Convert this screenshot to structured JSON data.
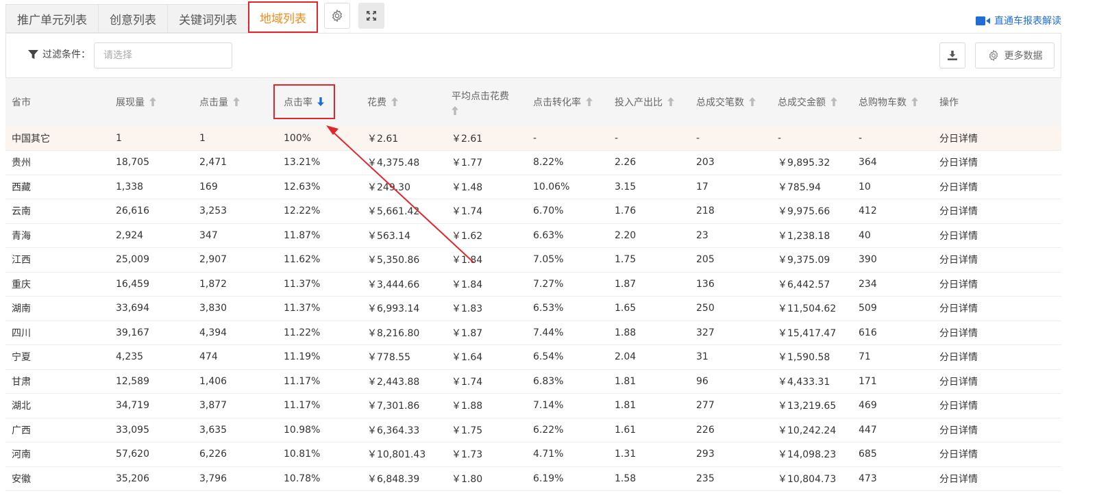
{
  "tabs": [
    {
      "label": "推广单元列表",
      "active": false
    },
    {
      "label": "创意列表",
      "active": false
    },
    {
      "label": "关键词列表",
      "active": false
    },
    {
      "label": "地域列表",
      "active": true
    }
  ],
  "help_link": "直通车报表解读",
  "filter": {
    "label": "过滤条件：",
    "placeholder": "请选择"
  },
  "more_data_label": "更多数据",
  "columns": [
    "省市",
    "展现量",
    "点击量",
    "点击率",
    "花费",
    "平均点击花费",
    "点击转化率",
    "投入产出比",
    "总成交笔数",
    "总成交金额",
    "总购物车数",
    "操作"
  ],
  "sorted_column": "点击率",
  "sort_direction": "desc",
  "rows": [
    [
      "中国其它",
      "1",
      "1",
      "100%",
      "￥2.61",
      "￥2.61",
      "-",
      "-",
      "-",
      "-",
      "-",
      "分日详情"
    ],
    [
      "贵州",
      "18,705",
      "2,471",
      "13.21%",
      "￥4,375.48",
      "￥1.77",
      "8.22%",
      "2.26",
      "203",
      "￥9,895.32",
      "364",
      "分日详情"
    ],
    [
      "西藏",
      "1,338",
      "169",
      "12.63%",
      "￥249.30",
      "￥1.48",
      "10.06%",
      "3.15",
      "17",
      "￥785.94",
      "10",
      "分日详情"
    ],
    [
      "云南",
      "26,616",
      "3,253",
      "12.22%",
      "￥5,661.42",
      "￥1.74",
      "6.70%",
      "1.76",
      "218",
      "￥9,975.66",
      "412",
      "分日详情"
    ],
    [
      "青海",
      "2,924",
      "347",
      "11.87%",
      "￥563.14",
      "￥1.62",
      "6.63%",
      "2.20",
      "23",
      "￥1,238.18",
      "40",
      "分日详情"
    ],
    [
      "江西",
      "25,009",
      "2,907",
      "11.62%",
      "￥5,350.86",
      "￥1.84",
      "7.05%",
      "1.75",
      "205",
      "￥9,375.09",
      "390",
      "分日详情"
    ],
    [
      "重庆",
      "16,459",
      "1,872",
      "11.37%",
      "￥3,444.66",
      "￥1.84",
      "7.27%",
      "1.87",
      "136",
      "￥6,442.57",
      "234",
      "分日详情"
    ],
    [
      "湖南",
      "33,694",
      "3,830",
      "11.37%",
      "￥6,993.14",
      "￥1.83",
      "6.53%",
      "1.65",
      "250",
      "￥11,504.62",
      "509",
      "分日详情"
    ],
    [
      "四川",
      "39,167",
      "4,394",
      "11.22%",
      "￥8,216.80",
      "￥1.87",
      "7.44%",
      "1.88",
      "327",
      "￥15,417.47",
      "616",
      "分日详情"
    ],
    [
      "宁夏",
      "4,235",
      "474",
      "11.19%",
      "￥778.55",
      "￥1.64",
      "6.54%",
      "2.04",
      "31",
      "￥1,590.58",
      "71",
      "分日详情"
    ],
    [
      "甘肃",
      "12,589",
      "1,406",
      "11.17%",
      "￥2,443.88",
      "￥1.74",
      "6.83%",
      "1.81",
      "96",
      "￥4,433.31",
      "171",
      "分日详情"
    ],
    [
      "湖北",
      "34,719",
      "3,877",
      "11.17%",
      "￥7,301.86",
      "￥1.88",
      "7.14%",
      "1.81",
      "277",
      "￥13,219.65",
      "469",
      "分日详情"
    ],
    [
      "广西",
      "33,095",
      "3,635",
      "10.98%",
      "￥6,364.33",
      "￥1.75",
      "6.22%",
      "1.61",
      "226",
      "￥10,242.24",
      "447",
      "分日详情"
    ],
    [
      "河南",
      "57,620",
      "6,226",
      "10.81%",
      "￥10,801.43",
      "￥1.73",
      "4.71%",
      "1.31",
      "293",
      "￥14,098.23",
      "685",
      "分日详情"
    ],
    [
      "安徽",
      "35,206",
      "3,796",
      "10.78%",
      "￥6,848.39",
      "￥1.80",
      "6.19%",
      "1.58",
      "235",
      "￥10,804.73",
      "473",
      "分日详情"
    ]
  ],
  "colors": {
    "accent": "#1e6ed6",
    "active_tab": "#f08c1c",
    "annotation": "#e0262b",
    "highlight_row": "#fcf4ef"
  }
}
